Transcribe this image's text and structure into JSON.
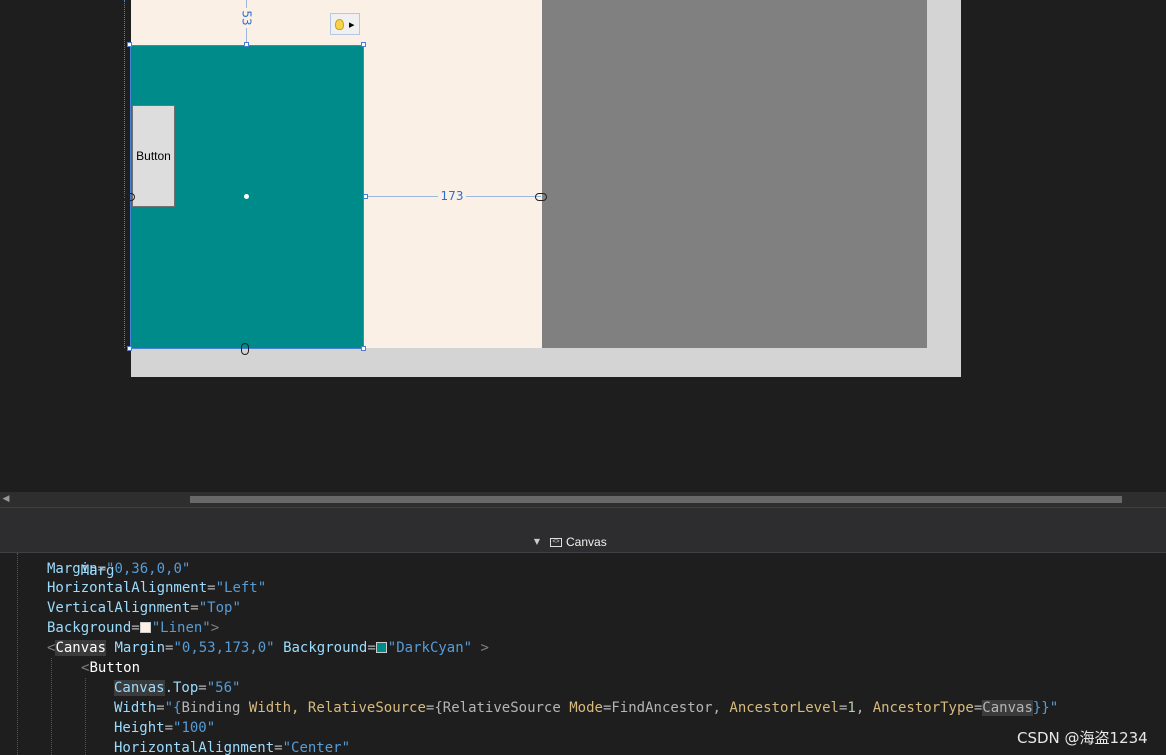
{
  "designer": {
    "measure_top": "53",
    "measure_right": "173",
    "preview_button_label": "Button",
    "colors": {
      "linen": "#faf0e6",
      "darkcyan": "#008b8b",
      "gray": "#808080",
      "frame": "#d4d4d4"
    }
  },
  "breadcrumb": {
    "dropdown_icon": "triangle-down-icon",
    "item_label": "Canvas"
  },
  "code": {
    "partial_line": "Marg",
    "line1": {
      "attr": "Margin",
      "value": "\"0,36,0,0\""
    },
    "line2": {
      "attr": "HorizontalAlignment",
      "value": "\"Left\""
    },
    "line3": {
      "attr": "VerticalAlignment",
      "value": "\"Top\""
    },
    "line4": {
      "attr": "Background",
      "value": "\"Linen\"",
      "close": ">"
    },
    "line5": {
      "open": "<",
      "tag": "Canvas",
      "attr1": "Margin",
      "value1": "\"0,53,173,0\"",
      "attr2": "Background",
      "value2": "\"DarkCyan\"",
      "close": " >"
    },
    "line6": {
      "open": "<",
      "tag": "Button"
    },
    "line7": {
      "owner": "Canvas",
      "prop": ".Top",
      "value": "\"56\""
    },
    "line8": {
      "attr": "Width",
      "q1": "\"{",
      "ext1": "Binding",
      "p1": " Width, ",
      "a1": "RelativeSource",
      "e1": "={",
      "ext2": "RelativeSource",
      "p2": " ",
      "a2": "Mode",
      "v2": "=FindAncestor, ",
      "a3": "AncestorLevel",
      "e3": "=",
      "n3": "1",
      "c3": ", ",
      "a4": "AncestorType",
      "e4": "=",
      "v4": "Canvas",
      "q2": "}}\""
    },
    "line9": {
      "attr": "Height",
      "value": "\"100\""
    },
    "line10": {
      "attr": "HorizontalAlignment",
      "value": "\"Center\""
    }
  },
  "watermark": "CSDN @海盗1234"
}
